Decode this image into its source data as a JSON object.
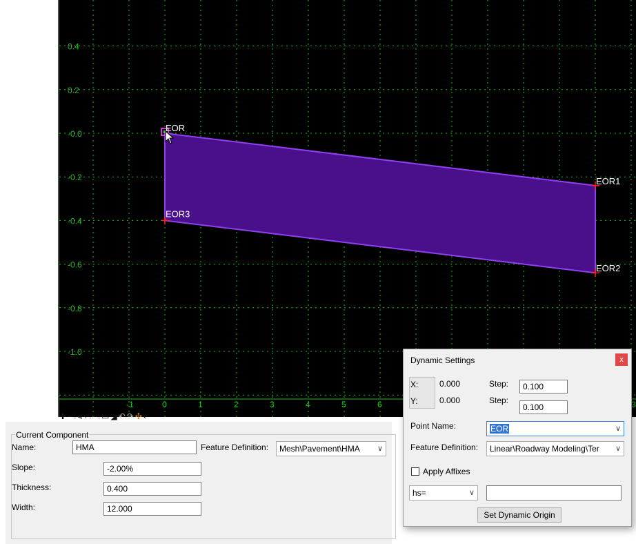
{
  "viewport": {
    "background": "#000000",
    "grid_color": "#20c020",
    "shape_fill": "#4a108c",
    "shape_stroke": "#9040f0",
    "y_ticks": [
      "0.4",
      "0.2",
      "-0.0",
      "-0.2",
      "-0.4",
      "-0.6",
      "-0.8",
      "-1.0"
    ],
    "x_ticks": [
      "-1",
      "0",
      "1",
      "2",
      "3",
      "4",
      "5",
      "6",
      "3"
    ],
    "points": [
      {
        "name": "EOR",
        "x": 0.0,
        "y": 0.0
      },
      {
        "name": "EOR1",
        "x": 12.0,
        "y": -0.24
      },
      {
        "name": "EOR2",
        "x": 12.0,
        "y": -0.64
      },
      {
        "name": "EOR3",
        "x": 0.0,
        "y": -0.4
      }
    ]
  },
  "toolbar": {
    "icons": [
      "plus-icon",
      "minus-icon",
      "join-icon",
      "split-icon",
      "insert-point-icon",
      "delete-point-icon",
      "rectangle-icon",
      "mirror-icon",
      "undo-icon",
      "redo-icon",
      "snap-icon",
      "arrow-left-icon"
    ],
    "glyphs": [
      "✚",
      "━",
      "⫶",
      "⫷",
      "+⫶",
      "−⫶",
      "▭",
      "◢",
      "↶",
      "↷",
      "✣",
      "‹"
    ]
  },
  "current_component": {
    "title": "Current Component",
    "name_label": "Name:",
    "name_value": "HMA",
    "feature_definition_label": "Feature Definition:",
    "feature_definition_value": "Mesh\\Pavement\\HMA",
    "slope_label": "Slope:",
    "slope_value": "-2.00%",
    "thickness_label": "Thickness:",
    "thickness_value": "0.400",
    "width_label": "Width:",
    "width_value": "12.000"
  },
  "dynamic_settings": {
    "title": "Dynamic Settings",
    "close": "x",
    "x_label": "X:",
    "x_value": "0.000",
    "y_label": "Y:",
    "y_value": "0.000",
    "step_label": "Step:",
    "step_x": "0.100",
    "step_y": "0.100",
    "point_name_label": "Point Name:",
    "point_name_value": "EOR",
    "feature_definition_label": "Feature Definition:",
    "feature_definition_value": "Linear\\Roadway Modeling\\Ter",
    "apply_affixes_label": "Apply Affixes",
    "affix_mode": "hs=",
    "affix_value": "",
    "set_origin_button": "Set Dynamic Origin"
  }
}
